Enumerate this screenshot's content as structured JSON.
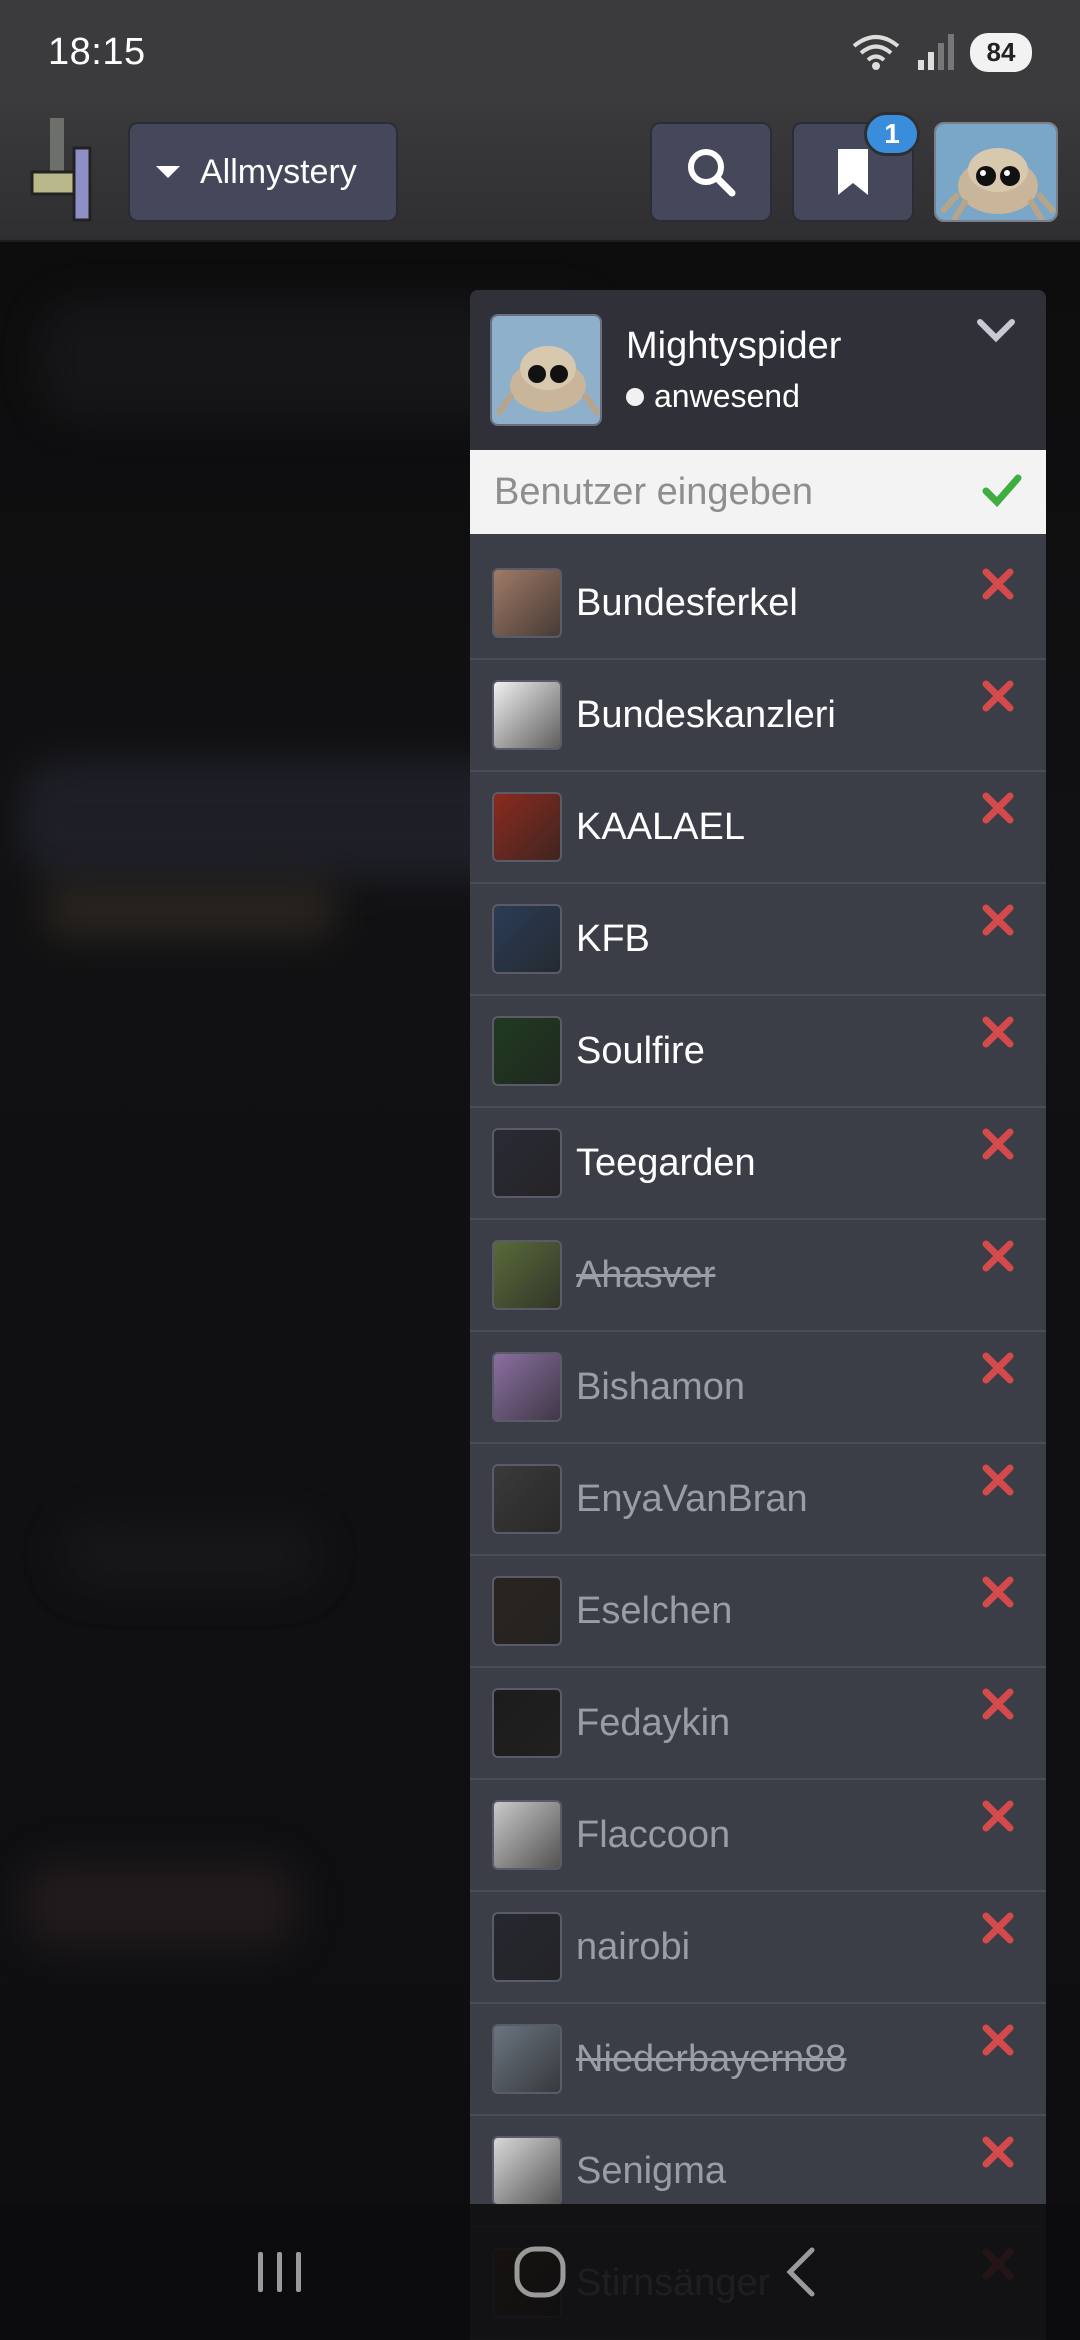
{
  "status_bar": {
    "time": "18:15",
    "battery": "84"
  },
  "header": {
    "site_label": "Allmystery",
    "bookmark_badge": "1"
  },
  "panel": {
    "current_user": {
      "name": "Mightyspider",
      "status": "anwesend"
    },
    "input_placeholder": "Benutzer eingeben",
    "users": [
      {
        "name": "Bundesferkel",
        "state": "online",
        "avatar_color": "#a07a66"
      },
      {
        "name": "Bundeskanzleri",
        "state": "online",
        "avatar_color": "#f0f0f0"
      },
      {
        "name": "KAALAEL",
        "state": "online",
        "avatar_color": "#8a2a1e"
      },
      {
        "name": "KFB",
        "state": "online",
        "avatar_color": "#2b3c55"
      },
      {
        "name": "Soulfire",
        "state": "online",
        "avatar_color": "#1f3a1f"
      },
      {
        "name": "Teegarden",
        "state": "online",
        "avatar_color": "#2a2a35"
      },
      {
        "name": "Ahasver",
        "state": "struck",
        "avatar_color": "#5a6a3a"
      },
      {
        "name": "Bishamon",
        "state": "offline",
        "avatar_color": "#8a6fa0"
      },
      {
        "name": "EnyaVanBran",
        "state": "offline",
        "avatar_color": "#3a3a3a"
      },
      {
        "name": "Eselchen",
        "state": "offline",
        "avatar_color": "#2a2420"
      },
      {
        "name": "Fedaykin",
        "state": "offline",
        "avatar_color": "#1c1c1c"
      },
      {
        "name": "Flaccoon",
        "state": "offline",
        "avatar_color": "#c9c9c9"
      },
      {
        "name": "nairobi",
        "state": "offline",
        "avatar_color": "#262830"
      },
      {
        "name": "Niederbayern88",
        "state": "struck",
        "avatar_color": "#6a7480"
      },
      {
        "name": "Senigma",
        "state": "offline",
        "avatar_color": "#d8d8d8"
      },
      {
        "name": "Stirnsänger",
        "state": "offline",
        "avatar_color": "#5a3a2a"
      }
    ]
  },
  "colors": {
    "remove_x": "#d24a4a",
    "confirm_check": "#3fae3f",
    "badge": "#3a8ddb"
  }
}
